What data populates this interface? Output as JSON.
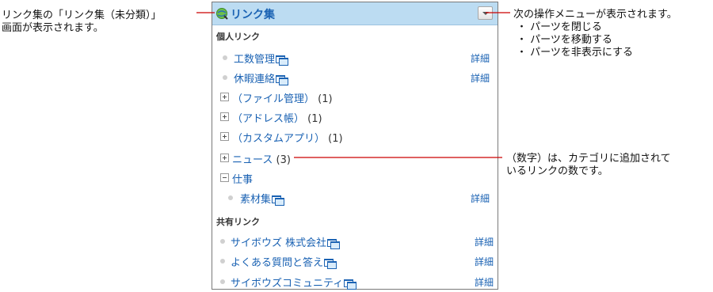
{
  "callouts": {
    "left": [
      "リンク集の「リンク集（未分類）」",
      "画面が表示されます。"
    ],
    "right": {
      "line1": "次の操作メニューが表示されます。",
      "items": [
        "・ パーツを閉じる",
        "・ パーツを移動する",
        "・ パーツを非表示にする"
      ]
    },
    "bottom": [
      "（数字）は、カテゴリに追加されて",
      "いるリンクの数です。"
    ]
  },
  "panel": {
    "title": "リンク集",
    "personal": {
      "heading": "個人リンク",
      "links": [
        {
          "label": "工数管理",
          "detail": "詳細"
        },
        {
          "label": "休暇連絡",
          "detail": "詳細"
        }
      ],
      "categories": [
        {
          "label": "（ファイル管理）",
          "count": "(1)"
        },
        {
          "label": "（アドレス帳）",
          "count": "(1)"
        },
        {
          "label": "（カスタムアプリ）",
          "count": "(1)"
        },
        {
          "label": "ニュース",
          "count": "(3)"
        }
      ],
      "open_category": {
        "label": "仕事",
        "links": [
          {
            "label": "素材集",
            "detail": "詳細"
          }
        ]
      }
    },
    "shared": {
      "heading": "共有リンク",
      "links": [
        {
          "label": "サイボウズ 株式会社",
          "detail": "詳細"
        },
        {
          "label": "よくある質問と答え",
          "detail": "詳細"
        },
        {
          "label": "サイボウズコミュニティ",
          "detail": "詳細"
        }
      ]
    }
  },
  "colors": {
    "accent": "#1a62b3",
    "header_bg": "#bcdcf2",
    "callout_line": "#cc0000"
  },
  "icons": {
    "logo": "globe-refresh-icon",
    "menu": "chevron-down-icon",
    "new_window": "new-window-icon",
    "expand": "plus-box-icon",
    "collapse": "minus-box-icon"
  }
}
